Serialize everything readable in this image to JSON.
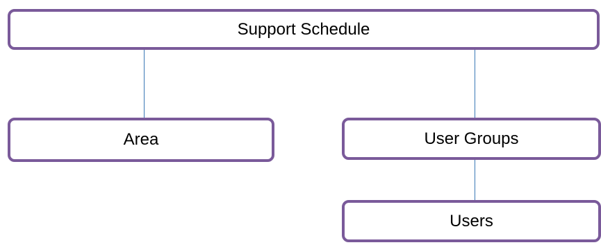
{
  "colors": {
    "node_border": "#7a5a9a",
    "connector": "#3a78b5",
    "node_fill": "#ffffff",
    "text": "#000000"
  },
  "diagram": {
    "root": {
      "label": "Support Schedule"
    },
    "area": {
      "label": "Area"
    },
    "user_groups": {
      "label": "User Groups"
    },
    "users": {
      "label": "Users"
    }
  },
  "edges": [
    {
      "from": "Support Schedule",
      "to": "Area"
    },
    {
      "from": "Support Schedule",
      "to": "User Groups"
    },
    {
      "from": "User Groups",
      "to": "Users"
    }
  ]
}
